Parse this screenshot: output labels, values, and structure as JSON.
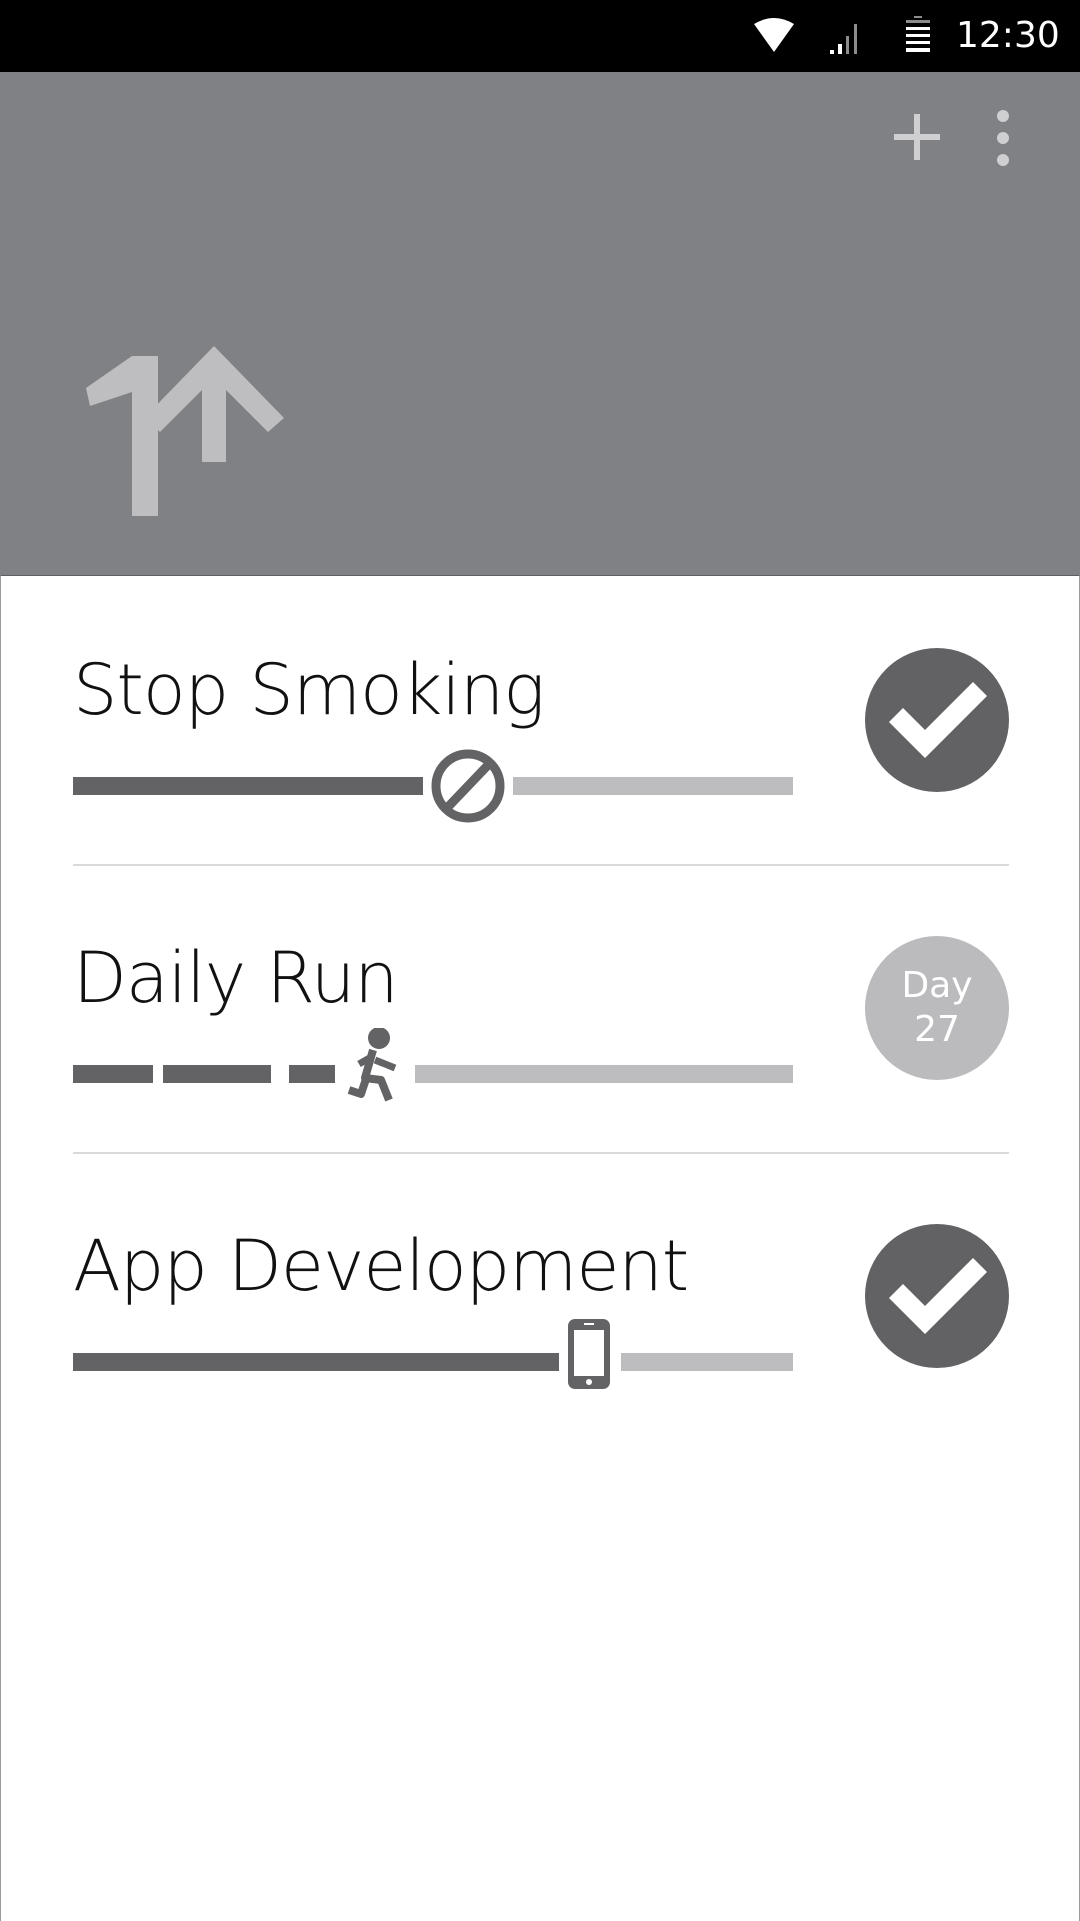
{
  "status_bar": {
    "time": "12:30",
    "icons": [
      "wifi-icon",
      "signal-icon",
      "battery-icon"
    ]
  },
  "header": {
    "logo_text": "1↑",
    "actions": [
      "add-icon",
      "more-vert-icon"
    ]
  },
  "goals": [
    {
      "title": "Stop Smoking",
      "marker_icon": "no-smoking-icon",
      "progress": 0.55,
      "action": "checkmark-icon"
    },
    {
      "title": "Daily Run",
      "marker_icon": "runner-icon",
      "progress": 0.42,
      "badge_line1": "Day",
      "badge_line2": "27"
    },
    {
      "title": "App Development",
      "marker_icon": "phone-icon",
      "progress": 0.72,
      "action": "checkmark-icon"
    }
  ],
  "colors": {
    "status_bar": "#000000",
    "header": "#808185",
    "track_done": "#636365",
    "track_remaining": "#bdbdbf",
    "badge": "#bbbbbd",
    "divider": "#d9d9d9"
  }
}
